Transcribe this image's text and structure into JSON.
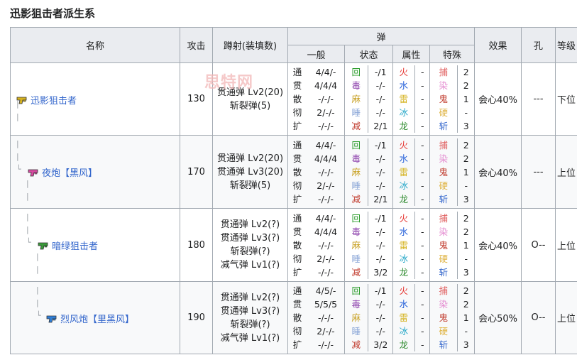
{
  "page": {
    "title": "迅影狙击者派生系"
  },
  "headers": {
    "name": "名称",
    "attack": "攻击",
    "ammo": "蹲射(装填数)",
    "bullet": "弹",
    "normal": "一般",
    "status": "状态",
    "element": "属性",
    "special": "特殊",
    "effect": "效果",
    "slot": "孔",
    "rank": "等级"
  },
  "watermark": "思特网",
  "labels": {
    "normal": [
      "通",
      "贯",
      "散",
      "彻",
      "扩"
    ],
    "status": [
      "回",
      "毒",
      "麻",
      "睡",
      "减"
    ],
    "element": [
      "火",
      "水",
      "雷",
      "冰",
      "龙"
    ],
    "special": [
      "捕",
      "染",
      "鬼",
      "硬",
      "斩"
    ]
  },
  "label_colors": {
    "status": [
      "#2e9d2e",
      "#8e44ad",
      "#c9a227",
      "#8da8d8",
      "#c0392b"
    ],
    "element": [
      "#e53935",
      "#1e5bd8",
      "#d4b21c",
      "#2aa9c9",
      "#2e8b2e"
    ],
    "special": [
      "#e06060",
      "#e48bd0",
      "#c0392b",
      "#e0b64a",
      "#3366cc"
    ]
  },
  "rows": [
    {
      "name": "迅影狙击者",
      "icon": "gun-icon-yellow",
      "icon_color": "#d6b21e",
      "attack": "130",
      "ammo": [
        "贯通弹 Lv2(20)",
        "斩裂弹(5)"
      ],
      "normal": [
        "4/4/-",
        "4/4/4",
        "-/-/-",
        "2/-/-",
        "-/-/-"
      ],
      "status": [
        "-/1",
        "-/-",
        "-/-",
        "-/-",
        "2/1"
      ],
      "element": [
        "-",
        "-",
        "-",
        "-",
        "-"
      ],
      "special": [
        "2",
        "2",
        "1",
        "-",
        "3"
      ],
      "effect": "会心40%",
      "slot": "---",
      "rank": "下位"
    },
    {
      "name": "夜炮【黑风】",
      "icon": "gun-icon-pink",
      "icon_color": "#d64aa0",
      "attack": "170",
      "ammo": [
        "贯通弹 Lv2(20)",
        "贯通弹 Lv3(20)",
        "斩裂弹(5)"
      ],
      "normal": [
        "4/4/-",
        "4/4/4",
        "-/-/-",
        "2/-/-",
        "-/-/-"
      ],
      "status": [
        "-/1",
        "-/-",
        "-/-",
        "-/-",
        "2/1"
      ],
      "element": [
        "-",
        "-",
        "-",
        "-",
        "-"
      ],
      "special": [
        "2",
        "2",
        "1",
        "-",
        "3"
      ],
      "effect": "会心40%",
      "slot": "---",
      "rank": "上位"
    },
    {
      "name": "暗绿狙击者",
      "icon": "gun-icon-green",
      "icon_color": "#3a9a3a",
      "attack": "180",
      "ammo": [
        "贯通弹 Lv2(?)",
        "贯通弹 Lv3(?)",
        "斩裂弹(?)",
        "减气弹 Lv1(?)"
      ],
      "normal": [
        "4/4/-",
        "4/4/4",
        "-/-/-",
        "2/-/-",
        "-/-/-"
      ],
      "status": [
        "-/1",
        "-/-",
        "-/-",
        "-/-",
        "3/2"
      ],
      "element": [
        "-",
        "-",
        "-",
        "-",
        "-"
      ],
      "special": [
        "2",
        "2",
        "1",
        "-",
        "3"
      ],
      "effect": "会心40%",
      "slot": "O--",
      "rank": "上位"
    },
    {
      "name": "烈风炮【里黑风】",
      "icon": "gun-icon-blue",
      "icon_color": "#2f7fd8",
      "attack": "190",
      "ammo": [
        "贯通弹 Lv2(?)",
        "贯通弹 Lv3(?)",
        "斩裂弹(?)",
        "减气弹 Lv1(?)"
      ],
      "normal": [
        "4/5/-",
        "5/5/5",
        "-/-/-",
        "2/-/-",
        "-/-/-"
      ],
      "status": [
        "-/1",
        "-/-",
        "-/-",
        "-/-",
        "3/2"
      ],
      "element": [
        "-",
        "-",
        "-",
        "-",
        "-"
      ],
      "special": [
        "2",
        "2",
        "1",
        "-",
        "3"
      ],
      "effect": "会心50%",
      "slot": "O--",
      "rank": "上位"
    }
  ]
}
